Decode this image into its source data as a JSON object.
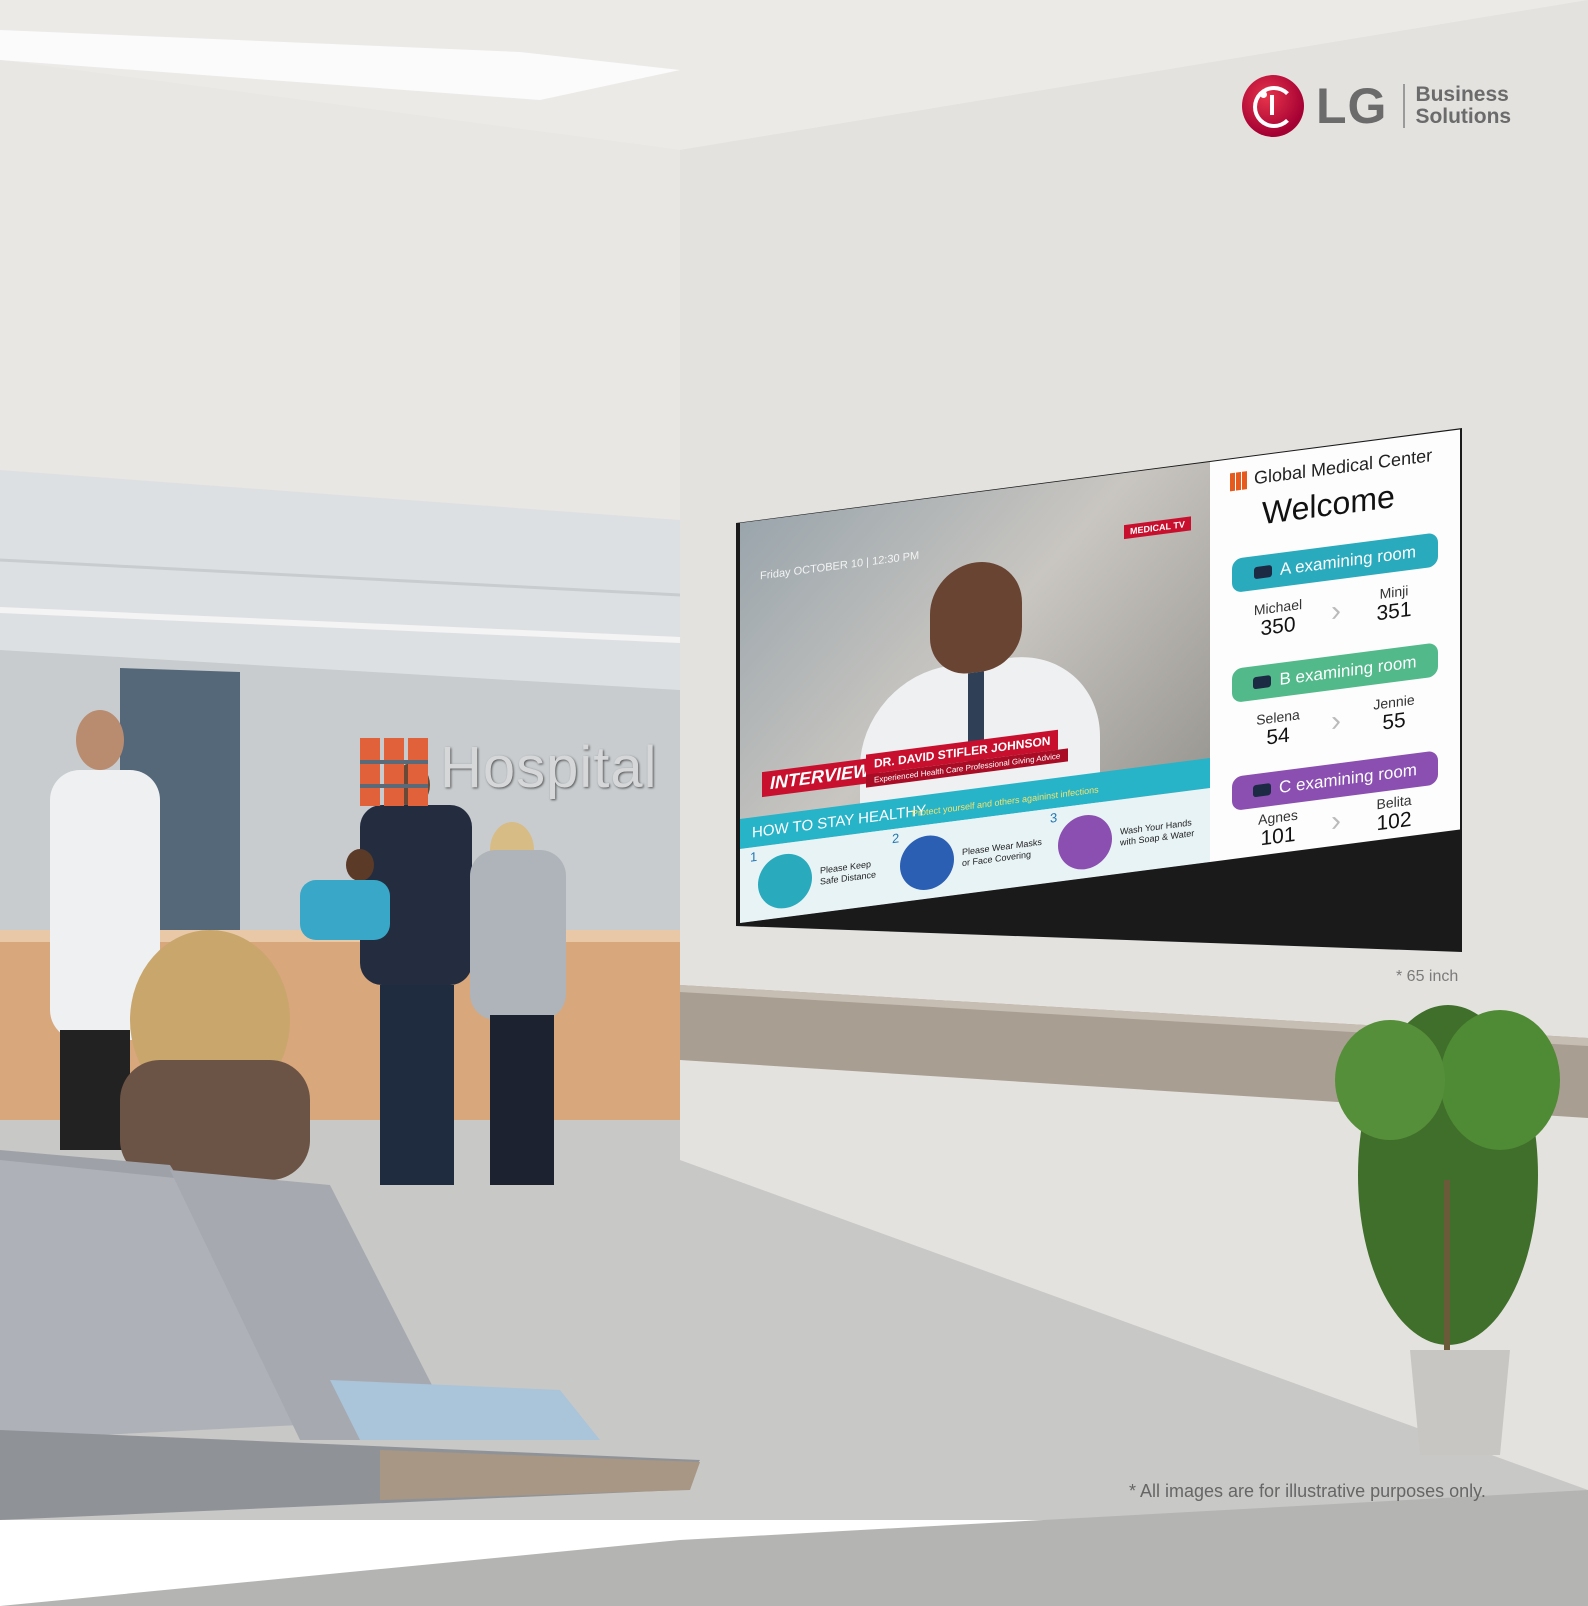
{
  "brand": {
    "name": "LG",
    "subtitle_line1": "Business",
    "subtitle_line2": "Solutions",
    "accent_color": "#a50034"
  },
  "wall_sign": {
    "text": "Hospital"
  },
  "screen": {
    "datetime": "Friday OCTOBER 10 | 12:30 PM",
    "channel_badge": "MEDICAL TV",
    "interview_label": "INTERVIEW",
    "guest_name": "DR. DAVID STIFLER JOHNSON",
    "guest_caption": "Experienced Health Care Professional Giving Advice",
    "healthy_title": "HOW TO STAY HEALTHY",
    "healthy_subtitle": "Protect yourself and others againinst infections",
    "tips": [
      {
        "number": "1",
        "text": "Please Keep Safe Distance",
        "color": "#2aaabd"
      },
      {
        "number": "2",
        "text": "Please Wear Masks or Face Covering",
        "color": "#2b5fb3"
      },
      {
        "number": "3",
        "text": "Wash Your Hands with Soap & Water",
        "color": "#8a4fb0"
      }
    ],
    "center_name": "Global Medical Center",
    "welcome": "Welcome",
    "rooms": [
      {
        "label": "A examining room",
        "color": "#2aaabd",
        "current_name": "Michael",
        "current_number": "350",
        "next_name": "Minji",
        "next_number": "351"
      },
      {
        "label": "B examining room",
        "color": "#52b98a",
        "current_name": "Selena",
        "current_number": "54",
        "next_name": "Jennie",
        "next_number": "55"
      },
      {
        "label": "C examining room",
        "color": "#8a4fb0",
        "current_name": "Agnes",
        "current_number": "101",
        "next_name": "Belita",
        "next_number": "102"
      }
    ]
  },
  "notes": {
    "size": "* 65 inch",
    "disclaimer": "* All images are for illustrative purposes only."
  }
}
